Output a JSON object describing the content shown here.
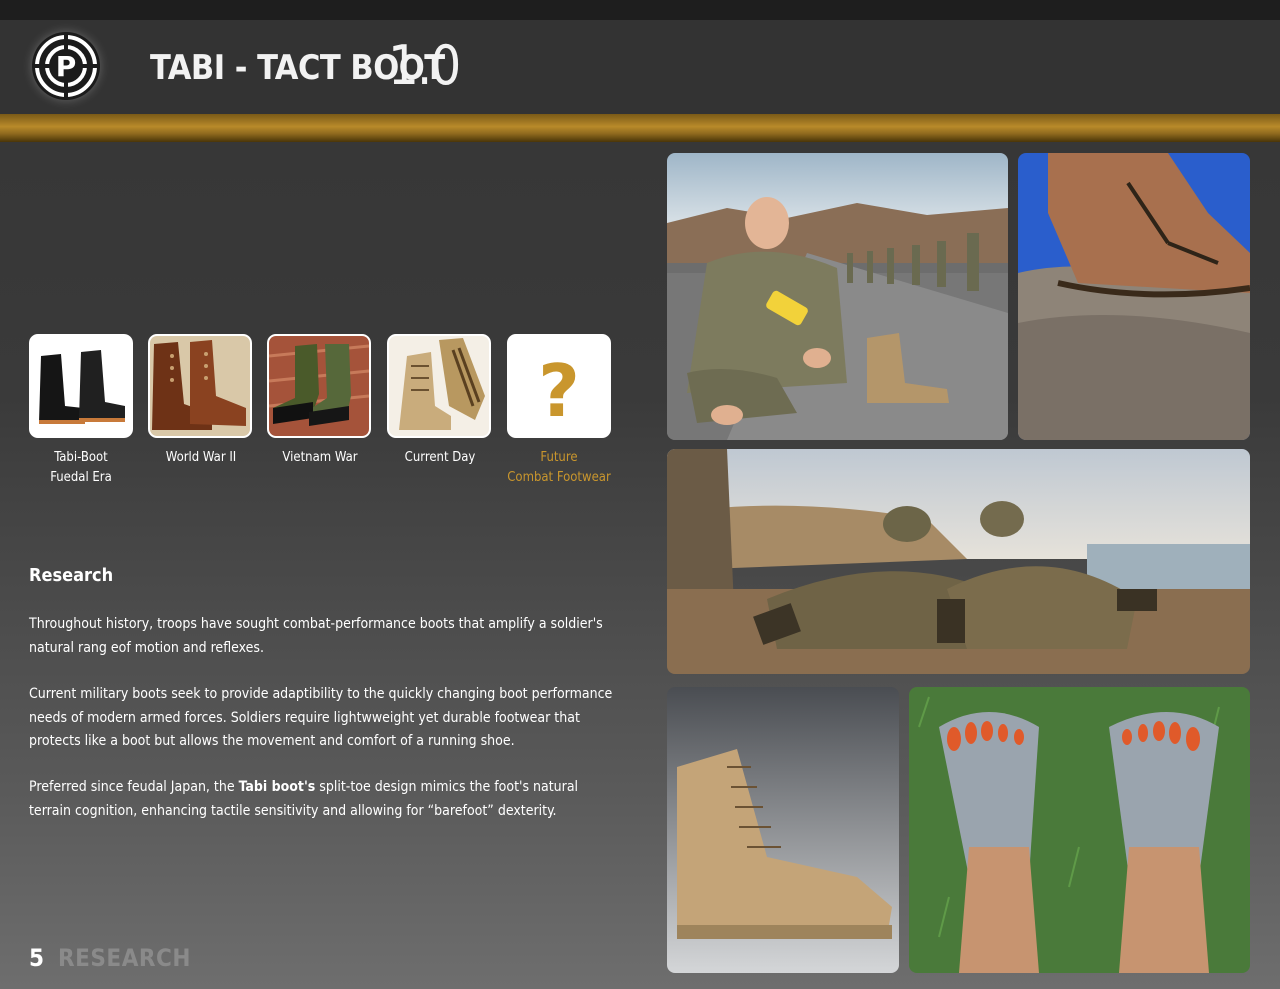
{
  "header": {
    "logo_letter": "P",
    "title": "TABI - TACT BOOT",
    "version": "1.0"
  },
  "eras": [
    {
      "label_line1": "Tabi-Boot",
      "label_line2": "Fuedal Era"
    },
    {
      "label_line1": "World War II",
      "label_line2": ""
    },
    {
      "label_line1": "Vietnam War",
      "label_line2": ""
    },
    {
      "label_line1": "Current Day",
      "label_line2": ""
    },
    {
      "label_line1": "Future",
      "label_line2": "Combat Footwear",
      "placeholder_symbol": "?"
    }
  ],
  "research": {
    "heading": "Research",
    "p1": "Throughout history, troops have sought combat-performance boots that amplify a soldier's natural rang eof motion and reflexes.",
    "p2": "Current military boots seek to provide adaptibility to the quickly changing boot performance needs of modern armed forces.  Soldiers require lightwweight yet durable footwear that protects like a boot but allows the movement and comfort of a running shoe.",
    "p3_before": "Preferred since feudal Japan, the ",
    "p3_bold": "Tabi boot's",
    "p3_after": " split-toe design mimics the foot's natural terrain cognition, enhancing tactile sensitivity and allowing for “barefoot” dexterity."
  },
  "footer": {
    "page_number": "5",
    "section": "RESEARCH"
  },
  "colors": {
    "accent_gold": "#c9962d",
    "background": "#3a3a3a",
    "header": "#333333"
  }
}
